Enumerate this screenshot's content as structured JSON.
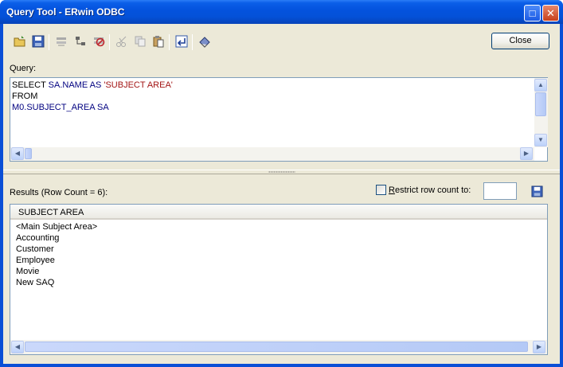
{
  "window": {
    "title": "Query Tool - ERwin ODBC"
  },
  "toolbar": {
    "icons": [
      "open-icon",
      "save-icon",
      "connect-icon",
      "tree-icon",
      "disconnect-icon",
      "cut-icon",
      "copy-icon",
      "paste-icon",
      "execute-icon",
      "clear-icon"
    ],
    "close_label": "Close"
  },
  "query": {
    "label": "Query:",
    "line1_kw": "SELECT ",
    "line1_ident": "SA.NAME AS ",
    "line1_str": "'SUBJECT AREA'",
    "line2": "FROM",
    "line3": "M0.SUBJECT_AREA SA"
  },
  "results": {
    "label": "Results (Row Count = 6):",
    "restrict_prefix": "R",
    "restrict_rest": "estrict row count to:",
    "restrict_checked": false,
    "row_limit": "",
    "column_header": "SUBJECT AREA",
    "rows": [
      "<Main Subject Area>",
      "Accounting",
      "Customer",
      "Employee",
      "Movie",
      "New SAQ"
    ]
  },
  "colors": {
    "title_bar": "#0453de",
    "accent": "#003c74",
    "string_literal": "#a31515",
    "identifier": "#000080"
  }
}
